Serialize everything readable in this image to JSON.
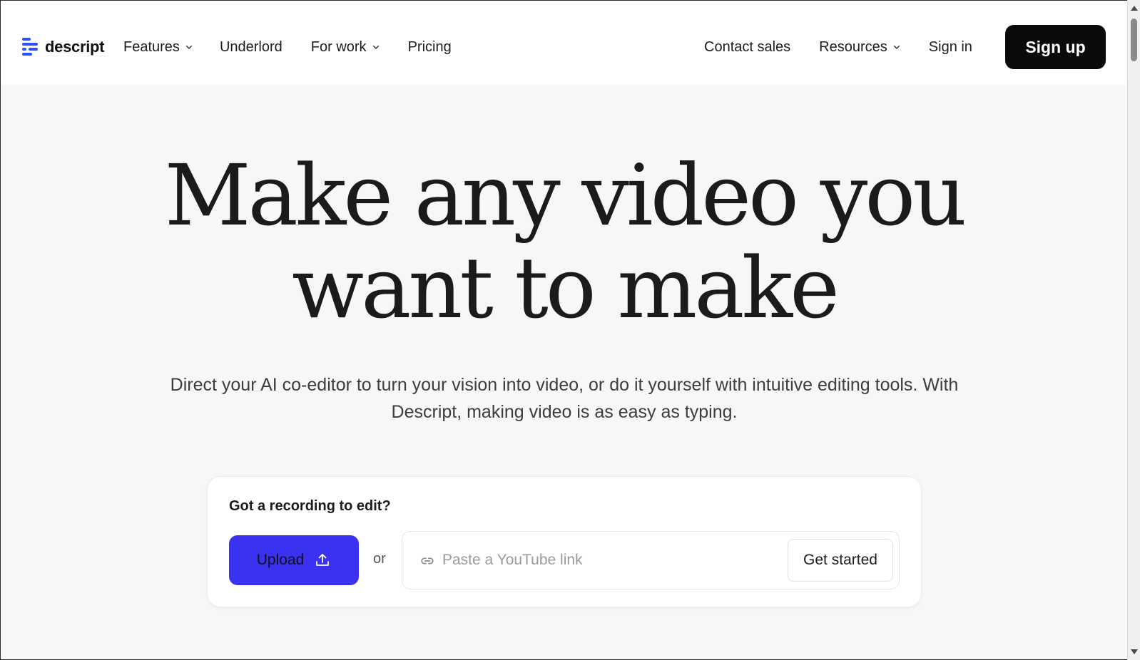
{
  "header": {
    "logo_text": "descript",
    "nav_left": [
      {
        "label": "Features",
        "dropdown": true
      },
      {
        "label": "Underlord",
        "dropdown": false
      },
      {
        "label": "For work",
        "dropdown": true
      },
      {
        "label": "Pricing",
        "dropdown": false
      }
    ],
    "nav_right": {
      "contact_sales": "Contact sales",
      "resources": "Resources",
      "sign_in": "Sign in",
      "sign_up": "Sign up"
    }
  },
  "hero": {
    "title_line1": "Make any video you",
    "title_line2": "want to make",
    "subtitle_line1": "Direct your AI co-editor to turn your vision into video, or do it yourself with intuitive editing tools. With",
    "subtitle_line2": "Descript, making video is as easy as typing."
  },
  "upload_card": {
    "title": "Got a recording to edit?",
    "upload_label": "Upload",
    "or_text": "or",
    "link_placeholder": "Paste a YouTube link",
    "link_value": "",
    "get_started_label": "Get started"
  },
  "colors": {
    "brand_blue": "#2d4ff5",
    "upload_button": "#3b31f0",
    "signup_button": "#0a0a0a",
    "page_background": "#f8f7f6"
  },
  "icons": {
    "upload": "upload-arrow-icon",
    "link": "link-chain-icon",
    "dropdown": "chevron-down-icon"
  }
}
